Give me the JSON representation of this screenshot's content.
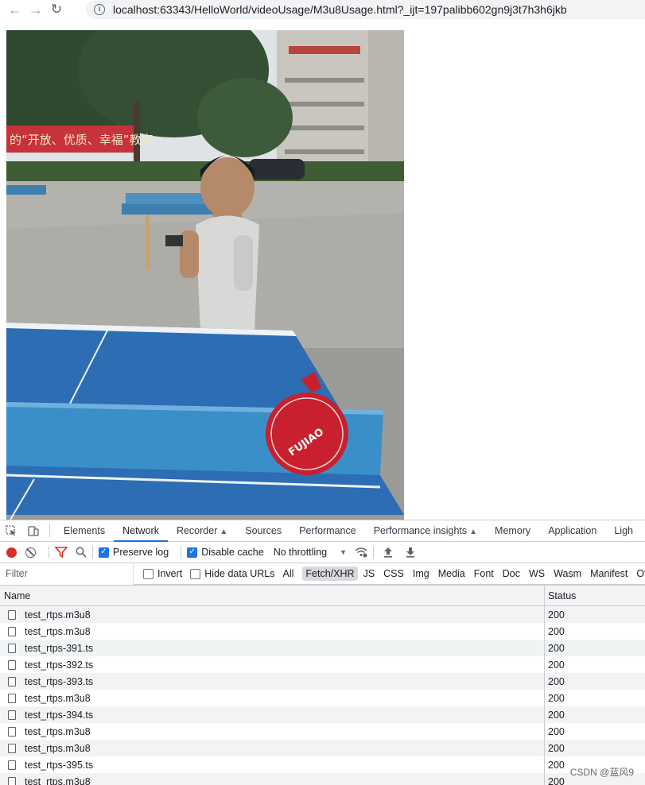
{
  "browser": {
    "url": "localhost:63343/HelloWorld/videoUsage/M3u8Usage.html?_ijt=197palibb602gn9j3t7h3h6jkb"
  },
  "video": {
    "banner_text": "的“开放、优质、幸福”教育",
    "paddle_brand": "FUJIAO"
  },
  "devtools": {
    "tabs": [
      {
        "label": "Elements"
      },
      {
        "label": "Network"
      },
      {
        "label": "Recorder"
      },
      {
        "label": "Sources"
      },
      {
        "label": "Performance"
      },
      {
        "label": "Performance insights"
      },
      {
        "label": "Memory"
      },
      {
        "label": "Application"
      },
      {
        "label": "Ligh"
      }
    ],
    "toolbar": {
      "preserve_log": "Preserve log",
      "disable_cache": "Disable cache",
      "throttling": "No throttling"
    },
    "filter": {
      "placeholder": "Filter",
      "invert": "Invert",
      "hide_data_urls": "Hide data URLs",
      "types": [
        "All",
        "Fetch/XHR",
        "JS",
        "CSS",
        "Img",
        "Media",
        "Font",
        "Doc",
        "WS",
        "Wasm",
        "Manifest",
        "Other"
      ]
    },
    "grid": {
      "col_name": "Name",
      "col_status": "Status",
      "rows": [
        {
          "name": "test_rtps.m3u8",
          "status": "200"
        },
        {
          "name": "test_rtps.m3u8",
          "status": "200"
        },
        {
          "name": "test_rtps-391.ts",
          "status": "200"
        },
        {
          "name": "test_rtps-392.ts",
          "status": "200"
        },
        {
          "name": "test_rtps-393.ts",
          "status": "200"
        },
        {
          "name": "test_rtps.m3u8",
          "status": "200"
        },
        {
          "name": "test_rtps-394.ts",
          "status": "200"
        },
        {
          "name": "test_rtps.m3u8",
          "status": "200"
        },
        {
          "name": "test_rtps.m3u8",
          "status": "200"
        },
        {
          "name": "test_rtps-395.ts",
          "status": "200"
        },
        {
          "name": "test_rtps.m3u8",
          "status": "200"
        }
      ]
    }
  },
  "watermark": "CSDN @蓝风9"
}
